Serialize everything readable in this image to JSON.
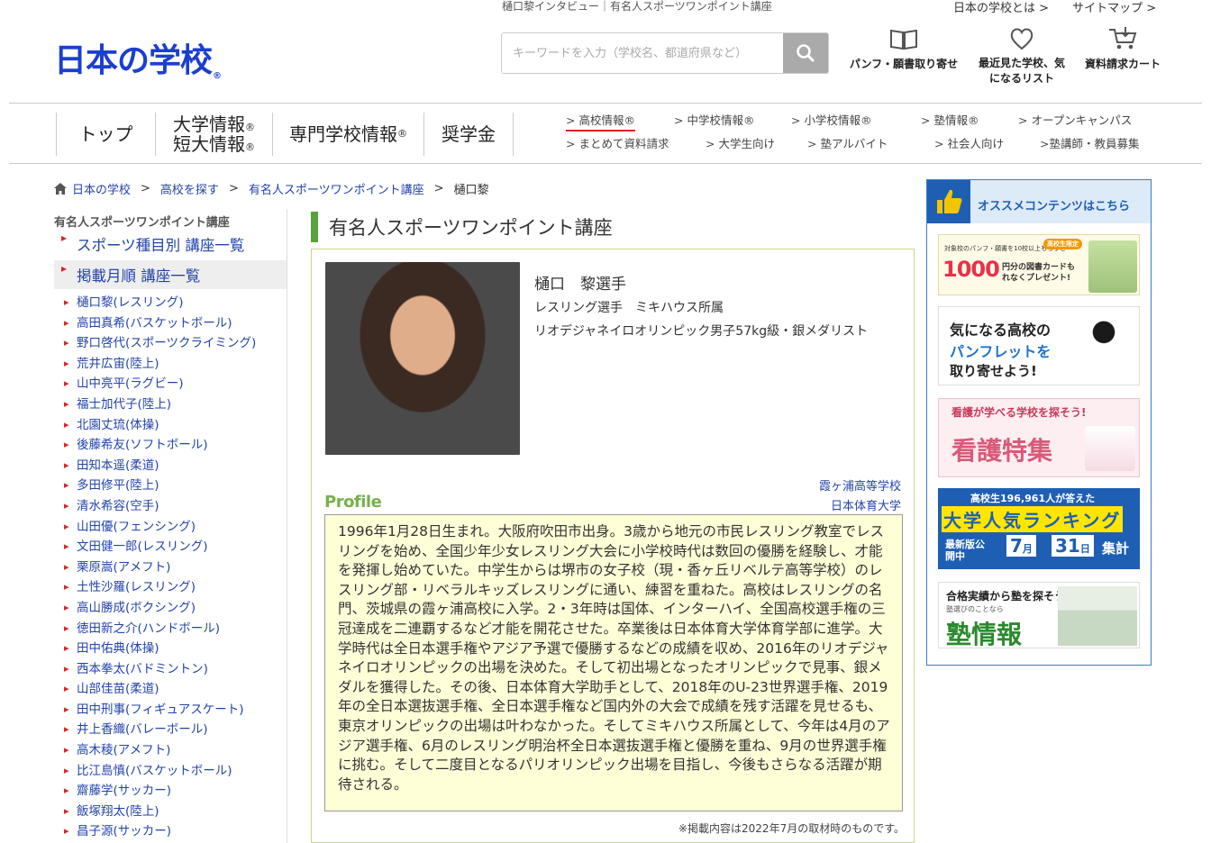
{
  "header": {
    "logo_text": "日本の学校",
    "page_breadcrumb": "樋口黎インタビュー｜有名人スポーツワンポイント講座",
    "util_links": [
      "日本の学校とは >",
      "サイトマップ >"
    ],
    "search_placeholder": "キーワードを入力（学校名、都道府県など）",
    "icons": [
      {
        "icon": "book-icon",
        "label": "パンフ・願書取り寄せ"
      },
      {
        "icon": "heart-icon",
        "label": "最近見た学校、気になるリスト"
      },
      {
        "icon": "cart-icon",
        "label": "資料請求カート"
      }
    ]
  },
  "gnav": {
    "main": [
      "トップ",
      "大学情報",
      "短大情報",
      "専門学校情報",
      "奨学金"
    ],
    "sub_row1": [
      "> 高校情報®",
      "> 中学校情報®",
      "> 小学校情報®",
      "> 塾情報®",
      "> オープンキャンパス"
    ],
    "sub_row2": [
      "> まとめて資料請求",
      "> 大学生向け",
      "> 塾アルバイト",
      "> 社会人向け",
      ">塾講師・教員募集"
    ]
  },
  "crumbs": {
    "home": "日本の学校",
    "c1": "高校を探す",
    "c2": "有名人スポーツワンポイント講座",
    "current": "樋口黎"
  },
  "sidebar": {
    "title": "有名人スポーツワンポイント講座",
    "link1": "スポーツ種目別 講座一覧",
    "link2": "掲載月順 講座一覧",
    "items": [
      "樋口黎(レスリング)",
      "高田真希(バスケットボール)",
      "野口啓代(スポーツクライミング)",
      "荒井広宙(陸上)",
      "山中亮平(ラグビー)",
      "福士加代子(陸上)",
      "北園丈琉(体操)",
      "後藤希友(ソフトボール)",
      "田知本遥(柔道)",
      "多田修平(陸上)",
      "清水希容(空手)",
      "山田優(フェンシング)",
      "文田健一郎(レスリング)",
      "栗原嵩(アメフト)",
      "土性沙羅(レスリング)",
      "高山勝成(ボクシング)",
      "徳田新之介(ハンドボール)",
      "田中佑典(体操)",
      "西本拳太(バドミントン)",
      "山部佳苗(柔道)",
      "田中刑事(フィギュアスケート)",
      "井上香織(バレーボール)",
      "高木稜(アメフト)",
      "比江島慎(バスケットボール)",
      "齋藤学(サッカー)",
      "飯塚翔太(陸上)",
      "昌子源(サッカー)"
    ]
  },
  "main": {
    "section_title": "有名人スポーツワンポイント講座",
    "name": "樋口　黎選手",
    "role": "レスリング選手　ミキハウス所属",
    "medal": "リオデジャネイロオリンピック男子57kg級・銀メダリスト",
    "school1": "霞ヶ浦高等学校",
    "school2": "日本体育大学",
    "profile_label": "Profile",
    "bio": "1996年1月28日生まれ。大阪府吹田市出身。3歳から地元の市民レスリング教室でレスリングを始め、全国少年少女レスリング大会に小学校時代は数回の優勝を経験し、才能を発揮し始めていた。中学生からは堺市の女子校（現・香ヶ丘リベルテ高等学校）のレスリング部・リベラルキッズレスリングに通い、練習を重ねた。高校はレスリングの名門、茨城県の霞ヶ浦高校に入学。2・3年時は国体、インターハイ、全国高校選手権の三冠達成を二連覇するなど才能を開花させた。卒業後は日本体育大学体育学部に進学。大学時代は全日本選手権やアジア予選で優勝するなどの成績を収め、2016年のリオデジャネイロオリンピックの出場を決めた。そして初出場となったオリンピックで見事、銀メダルを獲得した。その後、日本体育大学助手として、2018年のU-23世界選手権、2019年の全日本選抜選手権、全日本選手権など国内外の大会で成績を残す活躍を見せるも、東京オリンピックの出場は叶わなかった。そしてミキハウス所属として、今年は4月のアジア選手権、6月のレスリング明治杯全日本選抜選手権と優勝を重ね、9月の世界選手権に挑む。そして二度目となるパリオリンピック出場を目指し、今後もさらなる活躍が期待される。",
    "note": "※掲載内容は2022年7月の取材時のものです。"
  },
  "right": {
    "head": "オススメコンテンツはこちら",
    "b1_small": "対象校のパンフ・願書を10校以上もらうと",
    "b1_big": "1000",
    "b1_text": "円分の図書カードもれなくプレゼント!",
    "b1_badge": "高校生限定",
    "b2_l1": "気になる高校の",
    "b2_l2": "パンフレットを",
    "b2_l3": "取り寄せよう!",
    "b3_top": "看護が学べる学校を探そう!",
    "b3_main": "看護特集",
    "b4_top": "高校生196,961人が答えた",
    "b4_main": "大学人気ランキング",
    "b4_sub": "最新版公開中",
    "b4_date_m": "7",
    "b4_date_d": "31",
    "b4_m_unit": "月",
    "b4_d_unit": "日",
    "b4_end": "集計",
    "b5_top": "合格実績から塾を探そう",
    "b5_sub": "塾選びのことなら",
    "b5_main": "塾情報"
  }
}
